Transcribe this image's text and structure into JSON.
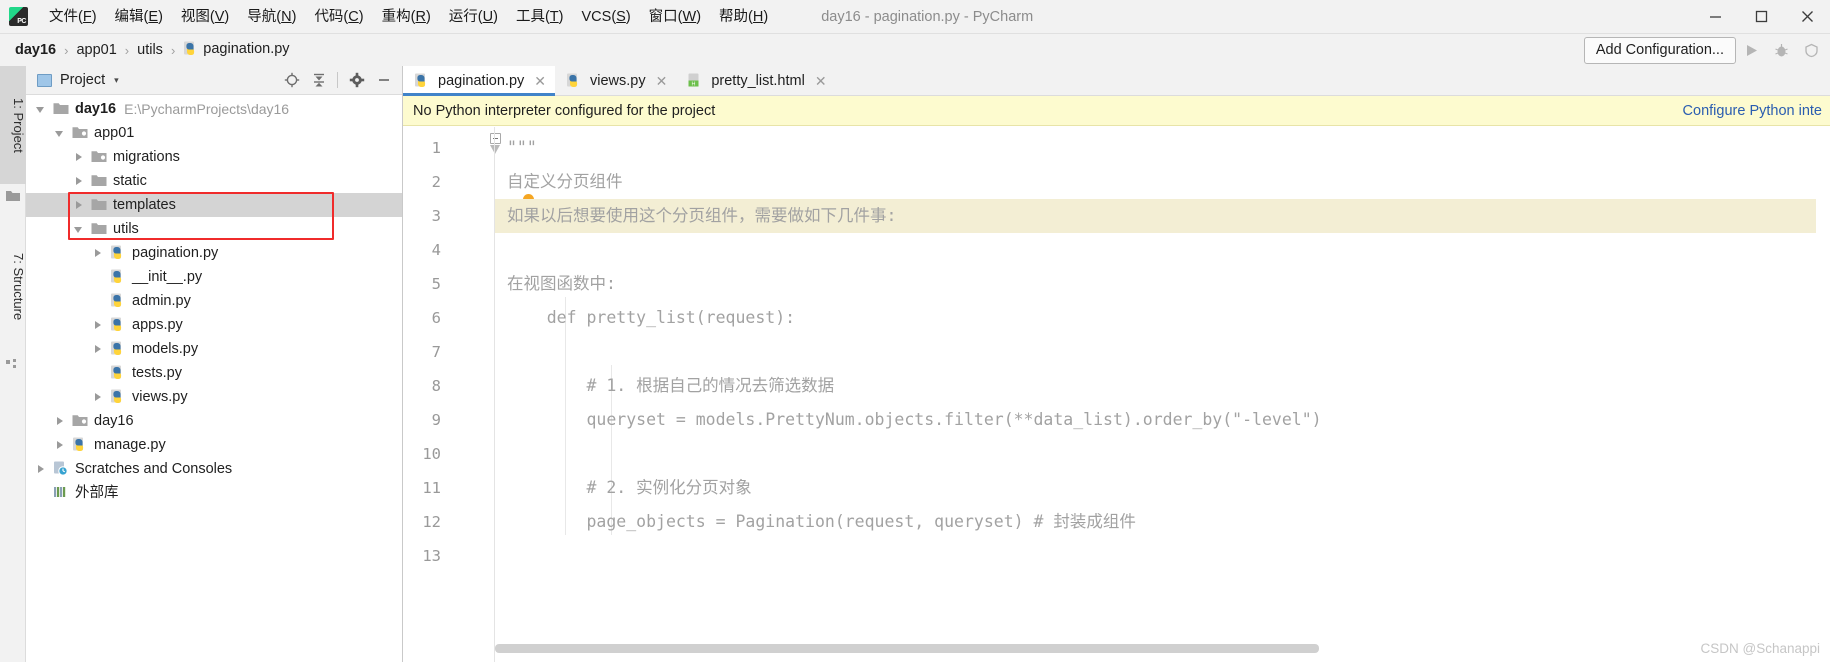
{
  "window": {
    "title": "day16 - pagination.py - PyCharm",
    "logo_alt": "pycharm-logo",
    "minimize": "—",
    "maximize": "❐",
    "close": "✕"
  },
  "menubar": {
    "items": [
      {
        "label": "文件(F)",
        "mnemonic": "F"
      },
      {
        "label": "编辑(E)",
        "mnemonic": "E"
      },
      {
        "label": "视图(V)",
        "mnemonic": "V"
      },
      {
        "label": "导航(N)",
        "mnemonic": "N"
      },
      {
        "label": "代码(C)",
        "mnemonic": "C"
      },
      {
        "label": "重构(R)",
        "mnemonic": "R"
      },
      {
        "label": "运行(U)",
        "mnemonic": "U"
      },
      {
        "label": "工具(T)",
        "mnemonic": "T"
      },
      {
        "label": "VCS(S)",
        "mnemonic": "S"
      },
      {
        "label": "窗口(W)",
        "mnemonic": "W"
      },
      {
        "label": "帮助(H)",
        "mnemonic": "H"
      }
    ]
  },
  "breadcrumb": {
    "separator": "›",
    "items": [
      {
        "label": "day16",
        "bold": true,
        "icon": "none"
      },
      {
        "label": "app01",
        "bold": false,
        "icon": "none"
      },
      {
        "label": "utils",
        "bold": false,
        "icon": "none"
      },
      {
        "label": "pagination.py",
        "bold": false,
        "icon": "python-file-icon"
      }
    ]
  },
  "navbar": {
    "add_configuration_label": "Add Configuration...",
    "run_icon": "run-icon",
    "debug_icon": "debug-icon",
    "coverage_icon": "coverage-icon"
  },
  "toolstrip": {
    "left_tabs": [
      {
        "label": "1: Project",
        "active": true,
        "icon": "project-icon"
      },
      {
        "label": "7: Structure",
        "active": false,
        "icon": "structure-icon"
      }
    ]
  },
  "project_panel": {
    "title": "Project",
    "caret": "▾",
    "actions": [
      {
        "name": "locate-icon",
        "glyph": "⊕"
      },
      {
        "name": "collapse-all-icon",
        "glyph": "↥"
      },
      {
        "name": "settings-gear-icon",
        "glyph": "⚙"
      },
      {
        "name": "hide-panel-icon",
        "glyph": "—"
      }
    ],
    "tree": [
      {
        "indent": 0,
        "arrow": "open",
        "icon": "folder-icon",
        "label": "day16",
        "bold": true,
        "note": "E:\\PycharmProjects\\day16",
        "selected": false
      },
      {
        "indent": 1,
        "arrow": "open",
        "icon": "source-folder-icon",
        "label": "app01",
        "bold": false,
        "note": "",
        "selected": false
      },
      {
        "indent": 2,
        "arrow": "closed",
        "icon": "source-folder-icon",
        "label": "migrations",
        "bold": false,
        "note": "",
        "selected": false
      },
      {
        "indent": 2,
        "arrow": "closed",
        "icon": "folder-icon",
        "label": "static",
        "bold": false,
        "note": "",
        "selected": false
      },
      {
        "indent": 2,
        "arrow": "closed",
        "icon": "folder-icon",
        "label": "templates",
        "bold": false,
        "note": "",
        "selected": true
      },
      {
        "indent": 2,
        "arrow": "open",
        "icon": "folder-icon",
        "label": "utils",
        "bold": false,
        "note": "",
        "selected": false
      },
      {
        "indent": 3,
        "arrow": "closed",
        "icon": "python-file-icon",
        "label": "pagination.py",
        "bold": false,
        "note": "",
        "selected": false
      },
      {
        "indent": 3,
        "arrow": "none",
        "icon": "python-file-icon",
        "label": "__init__.py",
        "bold": false,
        "note": "",
        "selected": false
      },
      {
        "indent": 3,
        "arrow": "none",
        "icon": "python-file-icon",
        "label": "admin.py",
        "bold": false,
        "note": "",
        "selected": false
      },
      {
        "indent": 3,
        "arrow": "closed",
        "icon": "python-file-icon",
        "label": "apps.py",
        "bold": false,
        "note": "",
        "selected": false
      },
      {
        "indent": 3,
        "arrow": "closed",
        "icon": "python-file-icon",
        "label": "models.py",
        "bold": false,
        "note": "",
        "selected": false
      },
      {
        "indent": 3,
        "arrow": "none",
        "icon": "python-file-icon",
        "label": "tests.py",
        "bold": false,
        "note": "",
        "selected": false
      },
      {
        "indent": 3,
        "arrow": "closed",
        "icon": "python-file-icon",
        "label": "views.py",
        "bold": false,
        "note": "",
        "selected": false
      },
      {
        "indent": 1,
        "arrow": "closed",
        "icon": "source-folder-icon",
        "label": "day16",
        "bold": false,
        "note": "",
        "selected": false
      },
      {
        "indent": 1,
        "arrow": "closed",
        "icon": "python-file-icon",
        "label": "manage.py",
        "bold": false,
        "note": "",
        "selected": false
      },
      {
        "indent": 0,
        "arrow": "closed",
        "icon": "scratches-icon",
        "label": "Scratches and Consoles",
        "bold": false,
        "note": "",
        "selected": false
      },
      {
        "indent": 0,
        "arrow": "none",
        "icon": "external-libs-icon",
        "label": "外部库",
        "bold": false,
        "note": "",
        "selected": false
      }
    ],
    "highlight_annotation": "red-box-around-utils-pagination"
  },
  "editor": {
    "tabs": [
      {
        "label": "pagination.py",
        "icon": "python-file-icon",
        "active": true,
        "close": "✕"
      },
      {
        "label": "views.py",
        "icon": "python-file-icon",
        "active": false,
        "close": "✕"
      },
      {
        "label": "pretty_list.html",
        "icon": "html-file-icon",
        "active": false,
        "close": "✕"
      }
    ],
    "notification": {
      "message": "No Python interpreter configured for the project",
      "link": "Configure Python inte"
    },
    "lines": [
      {
        "num": "1",
        "text": "\"\"\"",
        "indent": 0,
        "highlight": false
      },
      {
        "num": "2",
        "text": "自定义分页组件",
        "indent": 0,
        "highlight": false
      },
      {
        "num": "3",
        "text": "如果以后想要使用这个分页组件，需要做如下几件事:",
        "indent": 0,
        "highlight": true
      },
      {
        "num": "4",
        "text": "",
        "indent": 0,
        "highlight": false
      },
      {
        "num": "5",
        "text": "在视图函数中:",
        "indent": 0,
        "highlight": false
      },
      {
        "num": "6",
        "text": "    def pretty_list(request):",
        "indent": 0,
        "highlight": false
      },
      {
        "num": "7",
        "text": "",
        "indent": 0,
        "highlight": false
      },
      {
        "num": "8",
        "text": "        # 1. 根据自己的情况去筛选数据",
        "indent": 0,
        "highlight": false
      },
      {
        "num": "9",
        "text": "        queryset = models.PrettyNum.objects.filter(**data_list).order_by(\"-level\")",
        "indent": 0,
        "highlight": false
      },
      {
        "num": "10",
        "text": "",
        "indent": 0,
        "highlight": false
      },
      {
        "num": "11",
        "text": "        # 2. 实例化分页对象",
        "indent": 0,
        "highlight": false
      },
      {
        "num": "12",
        "text": "        page_objects = Pagination(request, queryset) # 封装成组件",
        "indent": 0,
        "highlight": false
      },
      {
        "num": "13",
        "text": "",
        "indent": 0,
        "highlight": false
      }
    ],
    "cursor_line": "3",
    "intention_bulb": "intention-bulb-icon",
    "fold_marker": "code-fold-marker"
  },
  "watermark": {
    "text": "CSDN @Schanappi"
  },
  "colors": {
    "accent_blue": "#4083c9",
    "notification_bg": "#fdfbcf",
    "highlight_line": "#f3eed4",
    "red_box": "#f02b2b",
    "code_text": "#a2a2a2",
    "link": "#2a5db0"
  }
}
